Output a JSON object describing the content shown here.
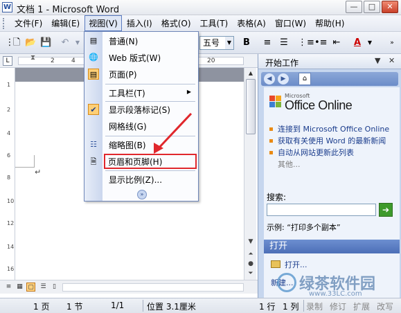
{
  "window": {
    "title": "文档 1 - Microsoft Word",
    "minimize": "—",
    "maximize": "□",
    "close": "✕"
  },
  "menubar": {
    "items": [
      "文件(F)",
      "编辑(E)",
      "视图(V)",
      "插入(I)",
      "格式(O)",
      "工具(T)",
      "表格(A)",
      "窗口(W)",
      "帮助(H)"
    ],
    "active_index": 2
  },
  "toolbar": {
    "font_size": "五号",
    "bold": "B",
    "italic": "I",
    "font_color_letter": "A"
  },
  "ruler": {
    "ticks": [
      "2",
      "4",
      "6",
      "8",
      "20"
    ]
  },
  "view_menu": {
    "items": [
      {
        "label": "普通(N)",
        "icon": "normal-view-icon"
      },
      {
        "label": "Web 版式(W)",
        "icon": "web-layout-icon"
      },
      {
        "label": "页面(P)",
        "icon": "print-layout-icon"
      },
      {
        "label": "工具栏(T)",
        "icon": "",
        "submenu": true
      },
      {
        "label": "显示段落标记(S)",
        "icon": "check-icon",
        "checked": true
      },
      {
        "label": "网格线(G)",
        "icon": ""
      },
      {
        "label": "缩略图(B)",
        "icon": "thumbnails-icon"
      },
      {
        "label": "页眉和页脚(H)",
        "icon": "header-footer-icon",
        "highlighted": true
      },
      {
        "label": "显示比例(Z)...",
        "icon": ""
      }
    ]
  },
  "vruler": {
    "ticks": [
      "1",
      "2",
      "4",
      "6",
      "8",
      "10",
      "12",
      "14",
      "16"
    ]
  },
  "task_pane": {
    "title": "开始工作",
    "logo_small": "Microsoft",
    "logo_main": "Office Online",
    "links": [
      {
        "text": "连接到 Microsoft Office Online"
      },
      {
        "text": "获取有关使用 Word 的最新新闻"
      },
      {
        "text": "自动从网站更新此列表"
      }
    ],
    "more": "其他...",
    "search_label": "搜索:",
    "search_value": "",
    "search_go": "➔",
    "example": "示例: “打印多个副本”",
    "open_section": "打开",
    "open_link": "打开...",
    "new_link": "新建..."
  },
  "statusbar": {
    "page": "1 页",
    "section": "1 节",
    "page_of": "1/1",
    "position": "位置 3.1厘米",
    "line": "1 行",
    "column": "1 列",
    "rec": "录制",
    "trk": "修订",
    "ext": "扩展",
    "ovr": "改写"
  },
  "watermark": {
    "text": "绿茶软件园",
    "url": "www.33LC.com"
  },
  "colors": {
    "highlight_border": "#e0272c",
    "menu_border": "#6e86b8",
    "task_pane_bg": "#c6d6ee",
    "check_bg": "#ffcf76"
  }
}
